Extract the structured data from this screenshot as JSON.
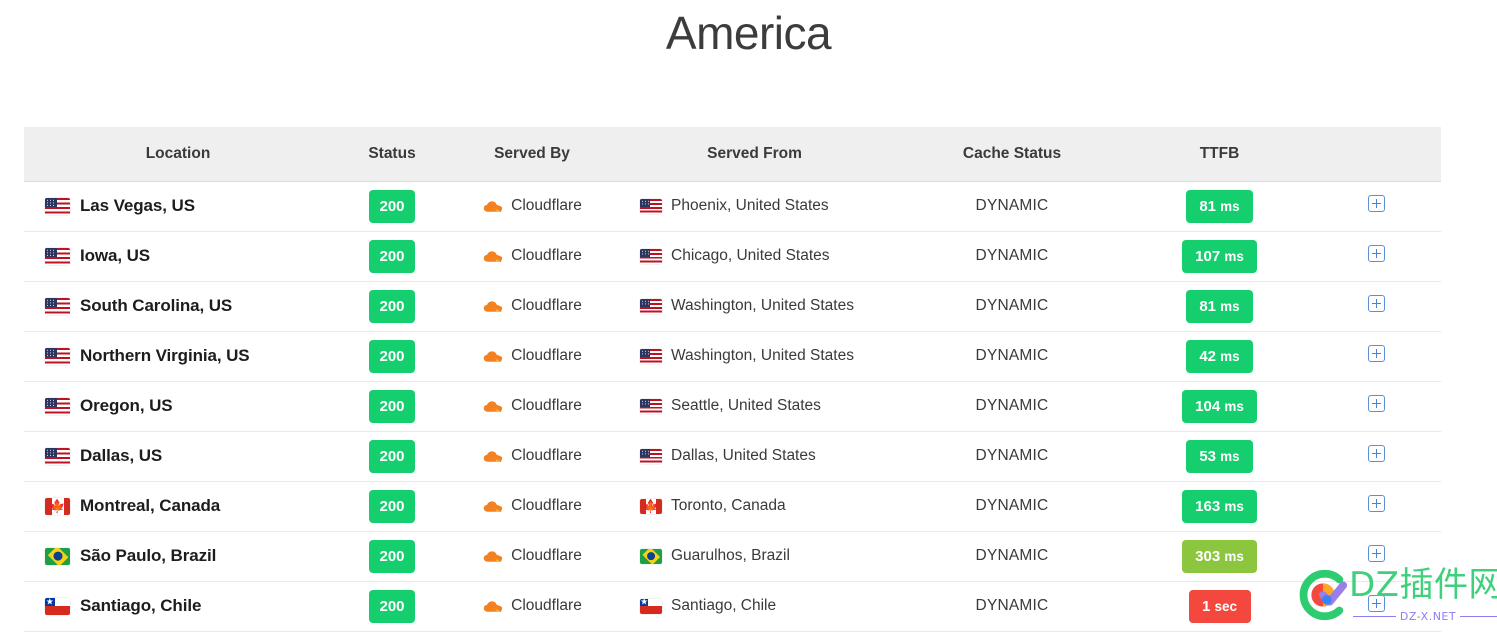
{
  "page": {
    "title": "America"
  },
  "table": {
    "columns": [
      {
        "key": "location",
        "label": "Location"
      },
      {
        "key": "status",
        "label": "Status"
      },
      {
        "key": "served_by",
        "label": "Served By"
      },
      {
        "key": "served_from",
        "label": "Served From"
      },
      {
        "key": "cache",
        "label": "Cache Status"
      },
      {
        "key": "ttfb",
        "label": "TTFB"
      },
      {
        "key": "expand",
        "label": ""
      }
    ],
    "rows": [
      {
        "flag": "us-flag-icon",
        "location": "Las Vegas, US",
        "status": "200",
        "status_color": "#15ce6e",
        "served_by": "Cloudflare",
        "served_by_icon": "cloudflare-icon",
        "from_flag": "us-flag-icon",
        "served_from": "Phoenix, United States",
        "cache": "DYNAMIC",
        "ttfb_value": "81",
        "ttfb_unit": "ms",
        "ttfb_color": "#15ce6e",
        "expand": "expand-plus-icon"
      },
      {
        "flag": "us-flag-icon",
        "location": "Iowa, US",
        "status": "200",
        "status_color": "#15ce6e",
        "served_by": "Cloudflare",
        "served_by_icon": "cloudflare-icon",
        "from_flag": "us-flag-icon",
        "served_from": "Chicago, United States",
        "cache": "DYNAMIC",
        "ttfb_value": "107",
        "ttfb_unit": "ms",
        "ttfb_color": "#15ce6e",
        "expand": "expand-plus-icon"
      },
      {
        "flag": "us-flag-icon",
        "location": "South Carolina, US",
        "status": "200",
        "status_color": "#15ce6e",
        "served_by": "Cloudflare",
        "served_by_icon": "cloudflare-icon",
        "from_flag": "us-flag-icon",
        "served_from": "Washington, United States",
        "cache": "DYNAMIC",
        "ttfb_value": "81",
        "ttfb_unit": "ms",
        "ttfb_color": "#15ce6e",
        "expand": "expand-plus-icon"
      },
      {
        "flag": "us-flag-icon",
        "location": "Northern Virginia, US",
        "status": "200",
        "status_color": "#15ce6e",
        "served_by": "Cloudflare",
        "served_by_icon": "cloudflare-icon",
        "from_flag": "us-flag-icon",
        "served_from": "Washington, United States",
        "cache": "DYNAMIC",
        "ttfb_value": "42",
        "ttfb_unit": "ms",
        "ttfb_color": "#15ce6e",
        "expand": "expand-plus-icon"
      },
      {
        "flag": "us-flag-icon",
        "location": "Oregon, US",
        "status": "200",
        "status_color": "#15ce6e",
        "served_by": "Cloudflare",
        "served_by_icon": "cloudflare-icon",
        "from_flag": "us-flag-icon",
        "served_from": "Seattle, United States",
        "cache": "DYNAMIC",
        "ttfb_value": "104",
        "ttfb_unit": "ms",
        "ttfb_color": "#15ce6e",
        "expand": "expand-plus-icon"
      },
      {
        "flag": "us-flag-icon",
        "location": "Dallas, US",
        "status": "200",
        "status_color": "#15ce6e",
        "served_by": "Cloudflare",
        "served_by_icon": "cloudflare-icon",
        "from_flag": "us-flag-icon",
        "served_from": "Dallas, United States",
        "cache": "DYNAMIC",
        "ttfb_value": "53",
        "ttfb_unit": "ms",
        "ttfb_color": "#15ce6e",
        "expand": "expand-plus-icon"
      },
      {
        "flag": "ca-flag-icon",
        "location": "Montreal, Canada",
        "status": "200",
        "status_color": "#15ce6e",
        "served_by": "Cloudflare",
        "served_by_icon": "cloudflare-icon",
        "from_flag": "ca-flag-icon",
        "served_from": "Toronto, Canada",
        "cache": "DYNAMIC",
        "ttfb_value": "163",
        "ttfb_unit": "ms",
        "ttfb_color": "#15ce6e",
        "expand": "expand-plus-icon"
      },
      {
        "flag": "br-flag-icon",
        "location": "São Paulo, Brazil",
        "status": "200",
        "status_color": "#15ce6e",
        "served_by": "Cloudflare",
        "served_by_icon": "cloudflare-icon",
        "from_flag": "br-flag-icon",
        "served_from": "Guarulhos, Brazil",
        "cache": "DYNAMIC",
        "ttfb_value": "303",
        "ttfb_unit": "ms",
        "ttfb_color": "#8cc63f",
        "expand": "expand-plus-icon"
      },
      {
        "flag": "cl-flag-icon",
        "location": "Santiago, Chile",
        "status": "200",
        "status_color": "#15ce6e",
        "served_by": "Cloudflare",
        "served_by_icon": "cloudflare-icon",
        "from_flag": "cl-flag-icon",
        "served_from": "Santiago, Chile",
        "cache": "DYNAMIC",
        "ttfb_value": "1",
        "ttfb_unit": "sec",
        "ttfb_color": "#f4483f",
        "expand": "expand-plus-icon"
      }
    ]
  },
  "watermark": {
    "text": "DZ插件网",
    "subtext": "DZ-X.NET"
  }
}
